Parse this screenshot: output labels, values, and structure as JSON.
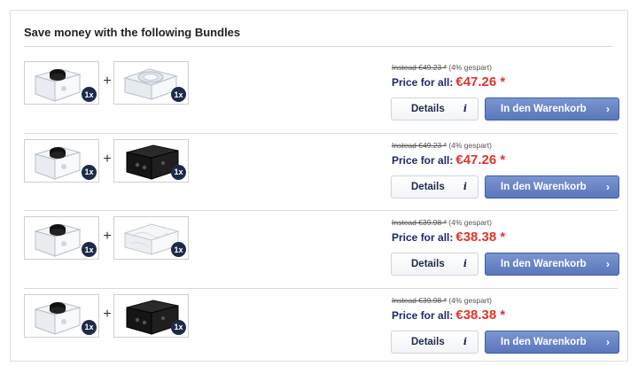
{
  "section": {
    "title": "Save money with the following Bundles"
  },
  "bundles": [
    {
      "item_a": {
        "image": "clear-block-with-black-knob",
        "qty": "1x"
      },
      "item_b": {
        "image": "clear-acrylic-reservoir-top",
        "qty": "1x"
      },
      "old_price_prefix": "Instead €49.23 *",
      "savings": "(4% gespart)",
      "price_label": "Price for all:",
      "price": "€47.26 *",
      "details_label": "Details",
      "info_glyph": "i",
      "cart_label": "In den Warenkorb",
      "cart_glyph": "›"
    },
    {
      "item_a": {
        "image": "clear-block-with-black-knob",
        "qty": "1x"
      },
      "item_b": {
        "image": "black-block-with-ports",
        "qty": "1x"
      },
      "old_price_prefix": "Instead €49.23 *",
      "savings": "(4% gespart)",
      "price_label": "Price for all:",
      "price": "€47.26 *",
      "details_label": "Details",
      "info_glyph": "i",
      "cart_label": "In den Warenkorb",
      "cart_glyph": "›"
    },
    {
      "item_a": {
        "image": "clear-block-with-black-knob",
        "qty": "1x"
      },
      "item_b": {
        "image": "frosted-clear-block",
        "qty": "1x"
      },
      "old_price_prefix": "Instead €39.98 *",
      "savings": "(4% gespart)",
      "price_label": "Price for all:",
      "price": "€38.38 *",
      "details_label": "Details",
      "info_glyph": "i",
      "cart_label": "In den Warenkorb",
      "cart_glyph": "›"
    },
    {
      "item_a": {
        "image": "clear-block-with-black-knob",
        "qty": "1x"
      },
      "item_b": {
        "image": "black-block-with-ports",
        "qty": "1x"
      },
      "old_price_prefix": "Instead €39.98 *",
      "savings": "(4% gespart)",
      "price_label": "Price for all:",
      "price": "€38.38 *",
      "details_label": "Details",
      "info_glyph": "i",
      "cart_label": "In den Warenkorb",
      "cart_glyph": "›"
    }
  ],
  "colors": {
    "price_red": "#e2342b",
    "label_navy": "#1d2a6a",
    "button_blue": "#5a77bd",
    "qty_badge": "#1d2a4a"
  }
}
